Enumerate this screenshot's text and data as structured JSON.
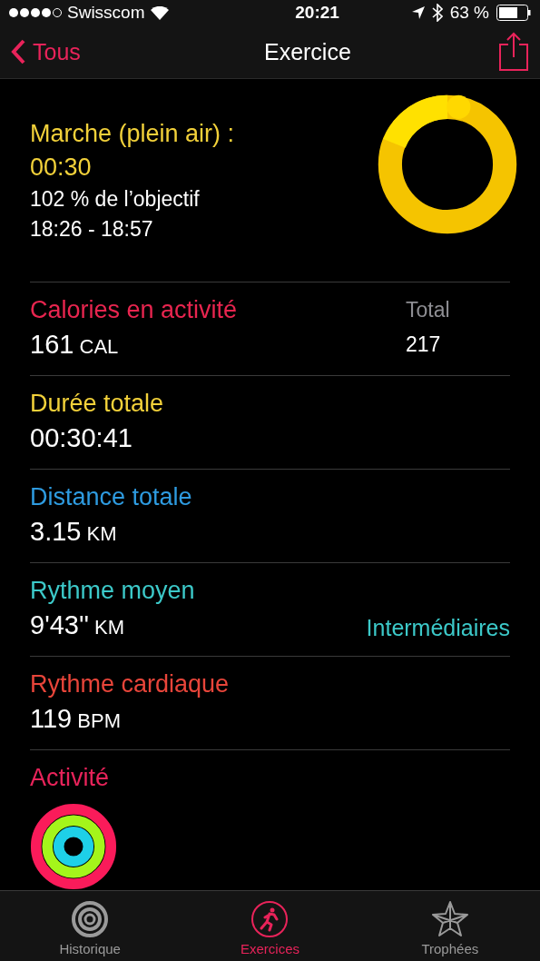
{
  "status_bar": {
    "carrier": "Swisscom",
    "signal_dots": [
      true,
      true,
      true,
      true,
      false
    ],
    "time": "20:21",
    "battery": "63 %"
  },
  "nav": {
    "back": "Tous",
    "title": "Exercice"
  },
  "workout": {
    "name": "Marche (plein air) :",
    "duration": "00:30",
    "goal": "102 % de l’objectif",
    "time_range": "18:26 - 18:57"
  },
  "metrics": [
    {
      "kind": "total",
      "label": "Calories en activité",
      "color": "#e8254f",
      "value": "161",
      "unit": "CAL",
      "side_label": "Total",
      "side_value": "217"
    },
    {
      "kind": "plain",
      "label": "Durée totale",
      "color": "#f2d13a",
      "value": "00:30:41"
    },
    {
      "kind": "plain",
      "label": "Distance totale",
      "color": "#2e9be0",
      "value": "3.15",
      "unit": "KM"
    },
    {
      "kind": "link",
      "label": "Rythme moyen",
      "color": "#3cc9c9",
      "value": "9'43''",
      "unit": "KM",
      "link": "Intermédiaires"
    },
    {
      "kind": "plain",
      "label": "Rythme cardiaque",
      "color": "#e8453a",
      "value": "119",
      "unit": "BPM"
    }
  ],
  "activity": {
    "label": "Activité"
  },
  "tabs": [
    {
      "label": "Historique",
      "selected": false
    },
    {
      "label": "Exercices",
      "selected": true
    },
    {
      "label": "Trophées",
      "selected": false
    }
  ]
}
